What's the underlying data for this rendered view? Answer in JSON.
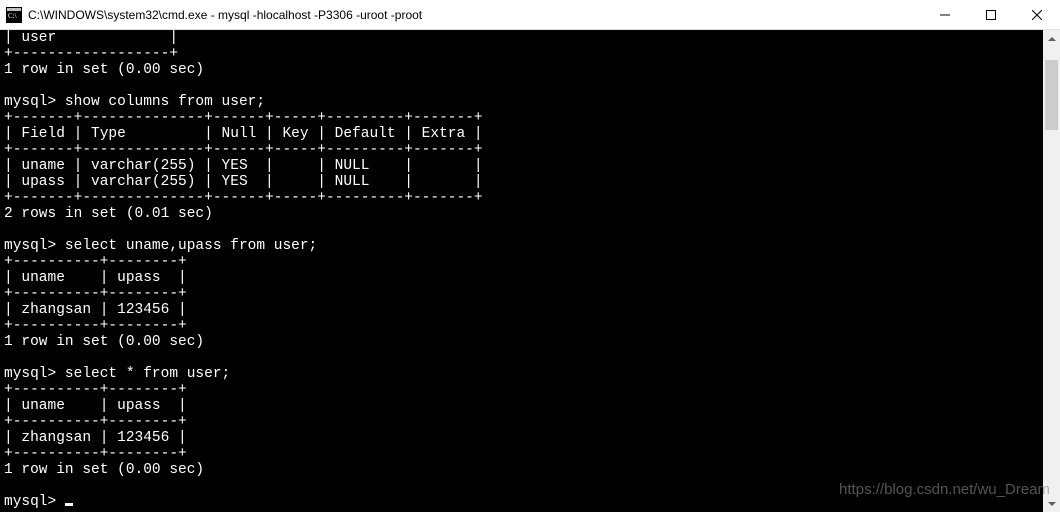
{
  "window": {
    "title": "C:\\WINDOWS\\system32\\cmd.exe - mysql  -hlocalhost -P3306 -uroot -proot"
  },
  "terminal": {
    "lines": [
      "| user             |",
      "+------------------+",
      "1 row in set (0.00 sec)",
      "",
      "mysql> show columns from user;",
      "+-------+--------------+------+-----+---------+-------+",
      "| Field | Type         | Null | Key | Default | Extra |",
      "+-------+--------------+------+-----+---------+-------+",
      "| uname | varchar(255) | YES  |     | NULL    |       |",
      "| upass | varchar(255) | YES  |     | NULL    |       |",
      "+-------+--------------+------+-----+---------+-------+",
      "2 rows in set (0.01 sec)",
      "",
      "mysql> select uname,upass from user;",
      "+----------+--------+",
      "| uname    | upass  |",
      "+----------+--------+",
      "| zhangsan | 123456 |",
      "+----------+--------+",
      "1 row in set (0.00 sec)",
      "",
      "mysql> select * from user;",
      "+----------+--------+",
      "| uname    | upass  |",
      "+----------+--------+",
      "| zhangsan | 123456 |",
      "+----------+--------+",
      "1 row in set (0.00 sec)",
      "",
      "mysql> "
    ]
  },
  "watermark": {
    "text": "https://blog.csdn.net/wu_Dream"
  }
}
